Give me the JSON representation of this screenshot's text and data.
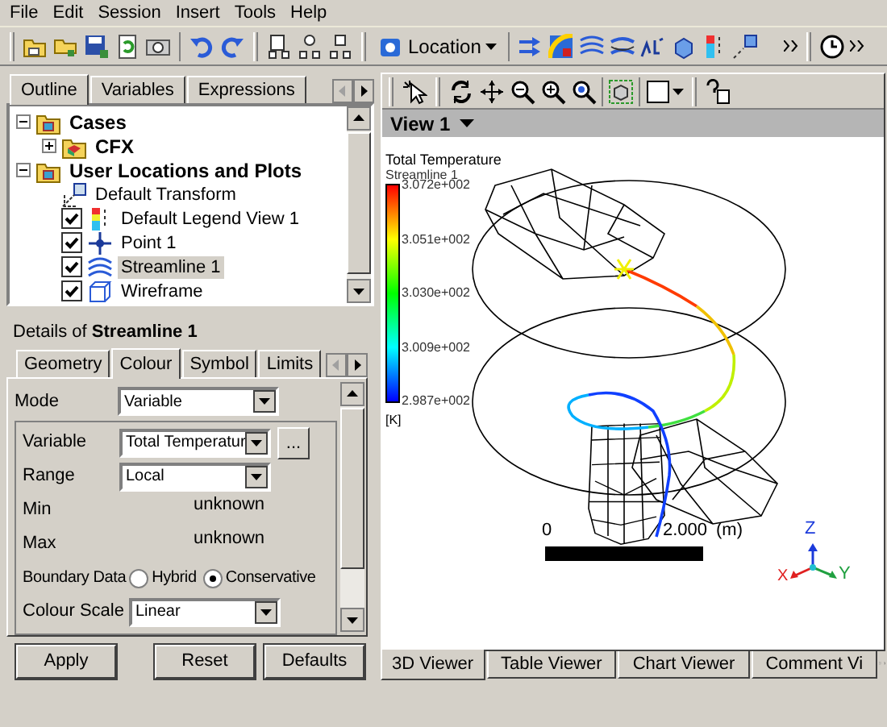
{
  "menu": [
    "File",
    "Edit",
    "Session",
    "Insert",
    "Tools",
    "Help"
  ],
  "toolbar": {
    "location_button": "Location"
  },
  "left_tabs": [
    {
      "label": "Outline",
      "selected": true
    },
    {
      "label": "Variables",
      "selected": false
    },
    {
      "label": "Expressions",
      "selected": false
    }
  ],
  "tree": [
    {
      "label": "Cases",
      "kind": "group",
      "expanded": true,
      "selected": false,
      "children": [
        {
          "label": "CFX",
          "kind": "case",
          "expanded": false,
          "selected": false
        }
      ]
    },
    {
      "label": "User Locations and Plots",
      "kind": "group",
      "expanded": true,
      "selected": false,
      "children": [
        {
          "label": "Default Transform",
          "kind": "transform",
          "selected": false
        },
        {
          "label": "Default Legend View 1",
          "kind": "legend",
          "checked": true,
          "selected": false
        },
        {
          "label": "Point 1",
          "kind": "point",
          "checked": true,
          "selected": false
        },
        {
          "label": "Streamline 1",
          "kind": "streamline",
          "checked": true,
          "selected": true
        },
        {
          "label": "Wireframe",
          "kind": "wireframe",
          "checked": true,
          "selected": false
        }
      ]
    }
  ],
  "details": {
    "title": "Details of **Streamline 1**",
    "tabs": [
      {
        "label": "Geometry",
        "selected": false
      },
      {
        "label": "Colour",
        "selected": true
      },
      {
        "label": "Symbol",
        "selected": false
      },
      {
        "label": "Limits",
        "selected": false
      }
    ],
    "mode": {
      "label": "Mode",
      "value": "Variable"
    },
    "fields": [
      {
        "kind": "select",
        "label": "Variable",
        "value": "Total Temperatur",
        "browse": "..."
      },
      {
        "kind": "select",
        "label": "Range",
        "value": "Local"
      },
      {
        "kind": "readout",
        "label": "Min",
        "value": "unknown"
      },
      {
        "kind": "readout",
        "label": "Max",
        "value": "unknown"
      },
      {
        "kind": "radio",
        "label": "Boundary Data",
        "options": [
          {
            "label": "Hybrid",
            "selected": false
          },
          {
            "label": "Conservative",
            "selected": true
          }
        ]
      },
      {
        "kind": "select",
        "label": "Colour Scale",
        "value": "Linear"
      }
    ]
  },
  "buttons": [
    "Apply",
    "Reset",
    "Defaults"
  ],
  "viewer": {
    "title": "View 1",
    "legend": {
      "title": "Total Temperature",
      "subtitle": "Streamline 1",
      "labels": [
        "3.072e+002",
        "3.051e+002",
        "3.030e+002",
        "3.009e+002",
        "2.987e+002"
      ],
      "unit": "[K]"
    },
    "scale": {
      "start": "0",
      "end": "2.000",
      "unit": "(m)"
    },
    "axes": {
      "x": "X",
      "y": "Y",
      "z": "Z"
    }
  },
  "bottom_tabs": [
    {
      "label": "3D Viewer",
      "selected": true
    },
    {
      "label": "Table Viewer",
      "selected": false
    },
    {
      "label": "Chart Viewer",
      "selected": false
    },
    {
      "label": "Comment Vi",
      "selected": false
    }
  ]
}
